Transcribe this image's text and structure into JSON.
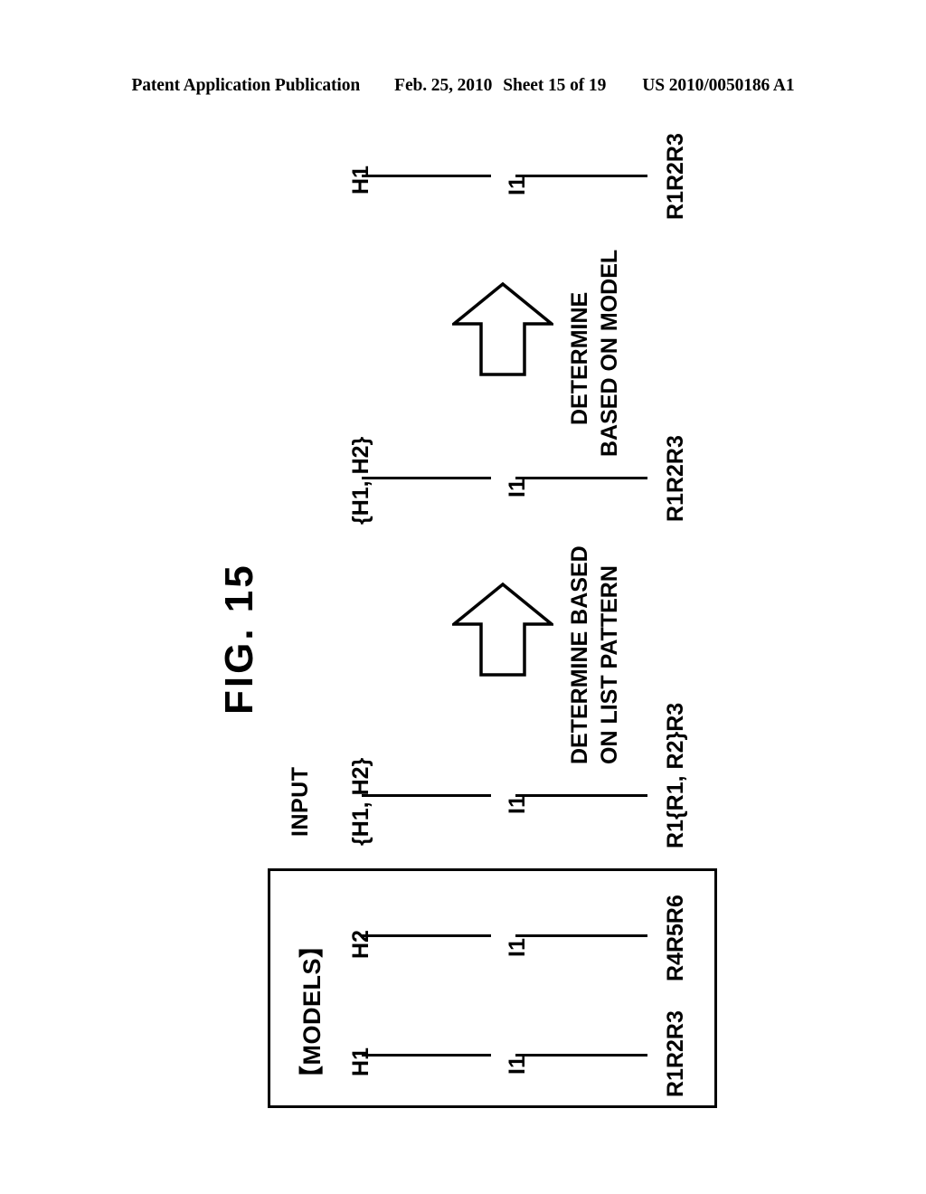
{
  "header": {
    "publication": "Patent Application Publication",
    "date": "Feb. 25, 2010",
    "sheet": "Sheet 15 of 19",
    "number": "US 2010/0050186 A1"
  },
  "figure": {
    "title": "FIG. 15",
    "input_label": "INPUT",
    "models_label": "【MODELS】",
    "stages": [
      {
        "name": "input-stage",
        "header": "{H1, H2}",
        "middle": "I1",
        "result": "R1{R1, R2}R3"
      },
      {
        "name": "list-pattern-stage",
        "header": "{H1, H2}",
        "middle": "I1",
        "result": "R1R2R3"
      },
      {
        "name": "model-stage",
        "header": "H1",
        "middle": "I1",
        "result": "R1R2R3"
      }
    ],
    "arrows": [
      {
        "name": "determine-list-pattern-arrow",
        "label_line1": "DETERMINE BASED",
        "label_line2": "ON LIST PATTERN"
      },
      {
        "name": "determine-model-arrow",
        "label_line1": "DETERMINE",
        "label_line2": "BASED ON MODEL"
      }
    ],
    "models": [
      {
        "name": "model-1",
        "header": "H1",
        "middle": "I1",
        "result": "R1R2R3"
      },
      {
        "name": "model-2",
        "header": "H2",
        "middle": "I1",
        "result": "R4R5R6"
      }
    ]
  },
  "colors": {
    "ink": "#000000",
    "paper": "#ffffff"
  }
}
